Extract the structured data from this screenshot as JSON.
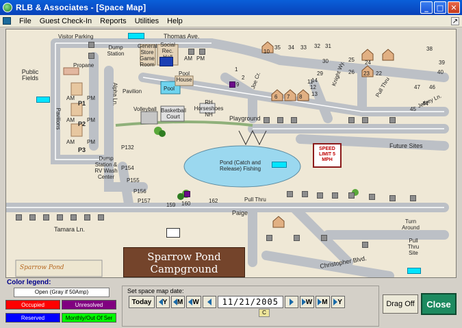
{
  "window": {
    "title": "RLB & Associates - [Space Map]",
    "buttons": [
      "_",
      "□",
      "✕"
    ]
  },
  "menu": {
    "items": [
      "File",
      "Guest Check-In",
      "Reports",
      "Utilities",
      "Help"
    ],
    "restore": "↗"
  },
  "map": {
    "labels": {
      "visitor_parking": "Visitor Parking",
      "dump_station_top": "Dump Station",
      "general_store": "General Store Game Room",
      "social_rec_hall": "Social Rec. Hall",
      "thomas_ave": "Thomas Ave.",
      "am1": "AM",
      "pm1": "PM",
      "propane": "Propane",
      "public_fields": "Public Fields",
      "pool_house": "Pool House",
      "pool": "Pool",
      "pavilion": "Pavilion",
      "volleyball": "Volleyball",
      "basketball": "Basketball Court",
      "horseshoes": "RH Horseshoes NH",
      "playground": "Playground",
      "joe_cr": "Joe Cr.",
      "knight_wy": "Knight Wy.",
      "pull_thru_top": "Pull Thru",
      "jeffrey_ln": "Jeffrey Ln.",
      "future_sites": "Future Sites",
      "alpha_ln": "Alpha Ln.",
      "pavilions": "Pavilions",
      "p1": "P1",
      "p2": "P2",
      "p3": "P3",
      "am_p1": "AM",
      "pm_p1": "PM",
      "am_p2": "AM",
      "pm_p2": "PM",
      "am_p3": "AM",
      "pm_p3": "PM",
      "dump_rv": "Dump Station & RV Wash Center",
      "pond": "Pond (Catch and Release) Fishing",
      "tamara_ln": "Tamara Ln.",
      "paige": "Paige",
      "pull_thru_mid": "Pull Thru",
      "turn_around": "Turn Around",
      "pull_thru_site": "Pull Thru Site",
      "christopher": "Christopher Blvd.",
      "site_132": "P132",
      "site_154": "P154",
      "site_155": "P155",
      "site_156": "P156",
      "site_157": "P157",
      "site_159": "159",
      "site_160": "160",
      "site_162": "162",
      "n9": "9",
      "n1": "1",
      "n2": "2",
      "n29": "29",
      "n30": "30",
      "n31": "31",
      "n32": "32",
      "n33": "33",
      "n34": "34",
      "n35": "35",
      "n22": "22",
      "n23": "23",
      "n24": "24",
      "n25": "25",
      "n26": "26",
      "n6": "6",
      "n7": "7",
      "n8": "8",
      "n10": "10",
      "n11": "11",
      "n12": "12",
      "n13": "13",
      "n14": "14",
      "n38": "38",
      "n39": "39",
      "n40": "40",
      "n44": "44",
      "n45": "45",
      "n46": "46",
      "n47": "47"
    },
    "speed_sign": "SPEED LIMIT 5 MPH",
    "campground_sign": "Sparrow Pond Campground",
    "logo_text": "Sparrow Pond"
  },
  "legend": {
    "title": "Color legend:",
    "open": "Open (Gray if 50Amp)",
    "items": [
      {
        "label": "Occupied",
        "color": "#ff0000"
      },
      {
        "label": "Unresolved",
        "color": "#800080"
      },
      {
        "label": "Reserved",
        "color": "#0000ff"
      },
      {
        "label": "Monthly/Out Of Ser",
        "color": "#00ff00"
      }
    ]
  },
  "date_nav": {
    "caption": "Set space map date:",
    "today": "Today",
    "y": "Y",
    "m": "M",
    "w": "W",
    "date": "11/21/2005",
    "calendar": "C"
  },
  "buttons": {
    "drag": "Drag Off",
    "close": "Close"
  }
}
